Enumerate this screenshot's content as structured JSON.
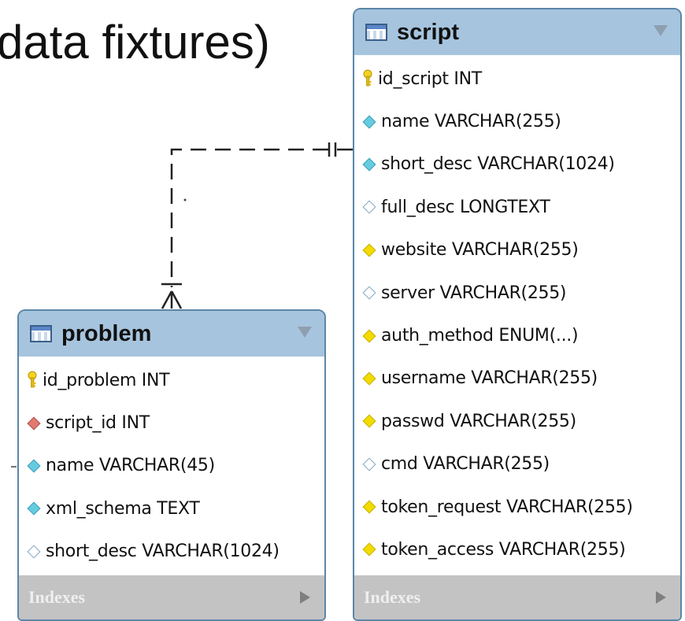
{
  "slide": {
    "title_fragment": "data fixtures)"
  },
  "tables": {
    "script": {
      "name": "script",
      "columns": [
        {
          "icon": "primary-key-icon",
          "text": "id_script INT"
        },
        {
          "icon": "cyan-diamond-icon",
          "text": "name VARCHAR(255)"
        },
        {
          "icon": "cyan-diamond-icon",
          "text": "short_desc VARCHAR(1024)"
        },
        {
          "icon": "white-diamond-icon",
          "text": "full_desc LONGTEXT"
        },
        {
          "icon": "yellow-diamond-icon",
          "text": "website VARCHAR(255)"
        },
        {
          "icon": "white-diamond-icon",
          "text": "server VARCHAR(255)"
        },
        {
          "icon": "yellow-diamond-icon",
          "text": "auth_method ENUM(...)"
        },
        {
          "icon": "yellow-diamond-icon",
          "text": "username VARCHAR(255)"
        },
        {
          "icon": "yellow-diamond-icon",
          "text": "passwd VARCHAR(255)"
        },
        {
          "icon": "white-diamond-icon",
          "text": "cmd VARCHAR(255)"
        },
        {
          "icon": "yellow-diamond-icon",
          "text": "token_request VARCHAR(255)"
        },
        {
          "icon": "yellow-diamond-icon",
          "text": "token_access VARCHAR(255)"
        }
      ],
      "indexes_label": "Indexes"
    },
    "problem": {
      "name": "problem",
      "columns": [
        {
          "icon": "primary-key-icon",
          "text": "id_problem INT"
        },
        {
          "icon": "red-diamond-icon",
          "text": "script_id INT"
        },
        {
          "icon": "cyan-diamond-icon",
          "text": "name VARCHAR(45)"
        },
        {
          "icon": "cyan-diamond-icon",
          "text": "xml_schema TEXT"
        },
        {
          "icon": "white-diamond-icon",
          "text": "short_desc VARCHAR(1024)"
        }
      ],
      "indexes_label": "Indexes"
    }
  },
  "colors": {
    "header": "#a6c4de",
    "border": "#5b86a8",
    "indexes_bar": "#c3c3c3",
    "connector": "#222222"
  }
}
